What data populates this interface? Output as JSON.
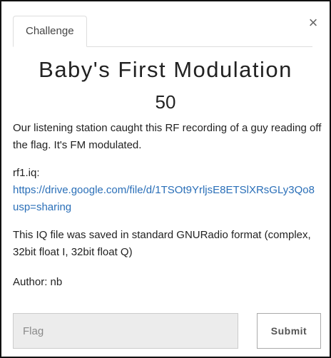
{
  "tabs": [
    {
      "label": "Challenge"
    }
  ],
  "close_icon": "×",
  "challenge": {
    "name": "Baby's First Modulation",
    "value": "50",
    "description": [
      "Our listening station caught this RF recording of a guy reading off the flag. It's FM modulated.",
      "rf1.iq:",
      "https://drive.google.com/file/d/1TSOt9YrljsE8ETSlXRsGLy3Qo8",
      "usp=sharing",
      "This IQ file was saved in standard GNURadio format (complex, 32bit float I, 32bit float Q)",
      "Author: nb"
    ]
  },
  "form": {
    "flag_placeholder": "Flag",
    "flag_value": "",
    "submit_label": "Submit"
  },
  "colors": {
    "link": "#2a6fb8",
    "input_background": "#ececec"
  }
}
